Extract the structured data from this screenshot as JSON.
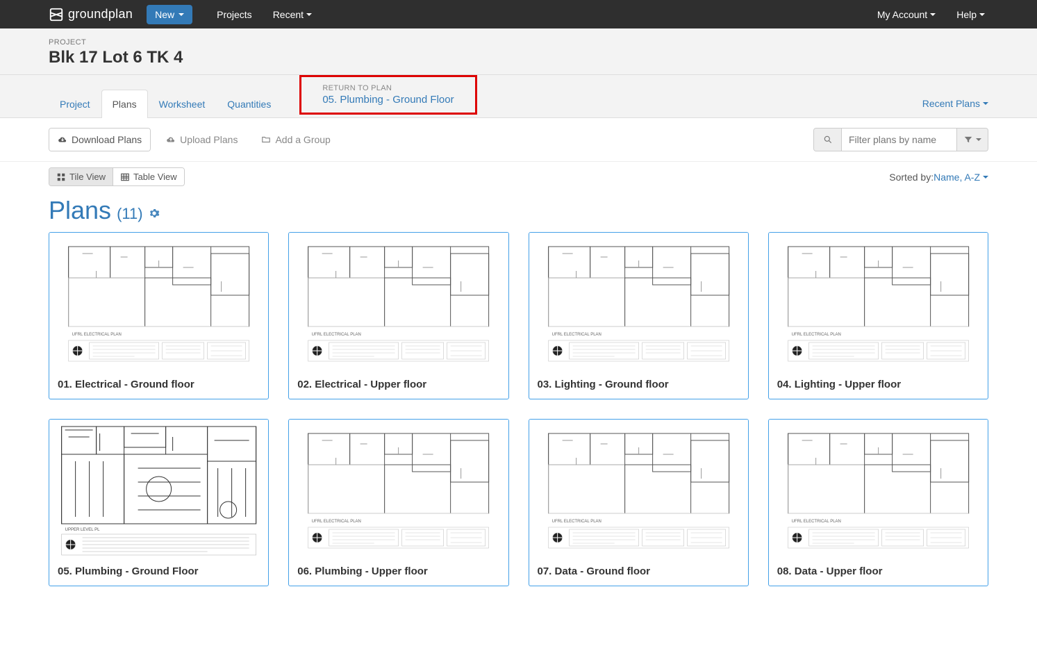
{
  "nav": {
    "brand": "groundplan",
    "new": "New",
    "projects": "Projects",
    "recent": "Recent",
    "account": "My Account",
    "help": "Help"
  },
  "project": {
    "label": "PROJECT",
    "title": "Blk 17 Lot 6 TK 4"
  },
  "tabs": {
    "project": "Project",
    "plans": "Plans",
    "worksheet": "Worksheet",
    "quantities": "Quantities"
  },
  "return": {
    "label": "RETURN TO PLAN",
    "plan": "05. Plumbing - Ground Floor"
  },
  "recent_plans": "Recent Plans",
  "toolbar": {
    "download": "Download Plans",
    "upload": "Upload Plans",
    "add_group": "Add a Group",
    "filter_placeholder": "Filter plans by name"
  },
  "views": {
    "tile": "Tile View",
    "table": "Table View"
  },
  "sort": {
    "label": "Sorted by: ",
    "value": "Name, A-Z"
  },
  "plans_header": {
    "title": "Plans",
    "count": "(11)"
  },
  "plans": [
    {
      "title": "01. Electrical - Ground floor"
    },
    {
      "title": "02. Electrical - Upper floor"
    },
    {
      "title": "03. Lighting - Ground floor"
    },
    {
      "title": "04. Lighting - Upper floor"
    },
    {
      "title": "05. Plumbing - Ground Floor"
    },
    {
      "title": "06. Plumbing - Upper floor"
    },
    {
      "title": "07. Data - Ground floor"
    },
    {
      "title": "08. Data - Upper floor"
    }
  ]
}
